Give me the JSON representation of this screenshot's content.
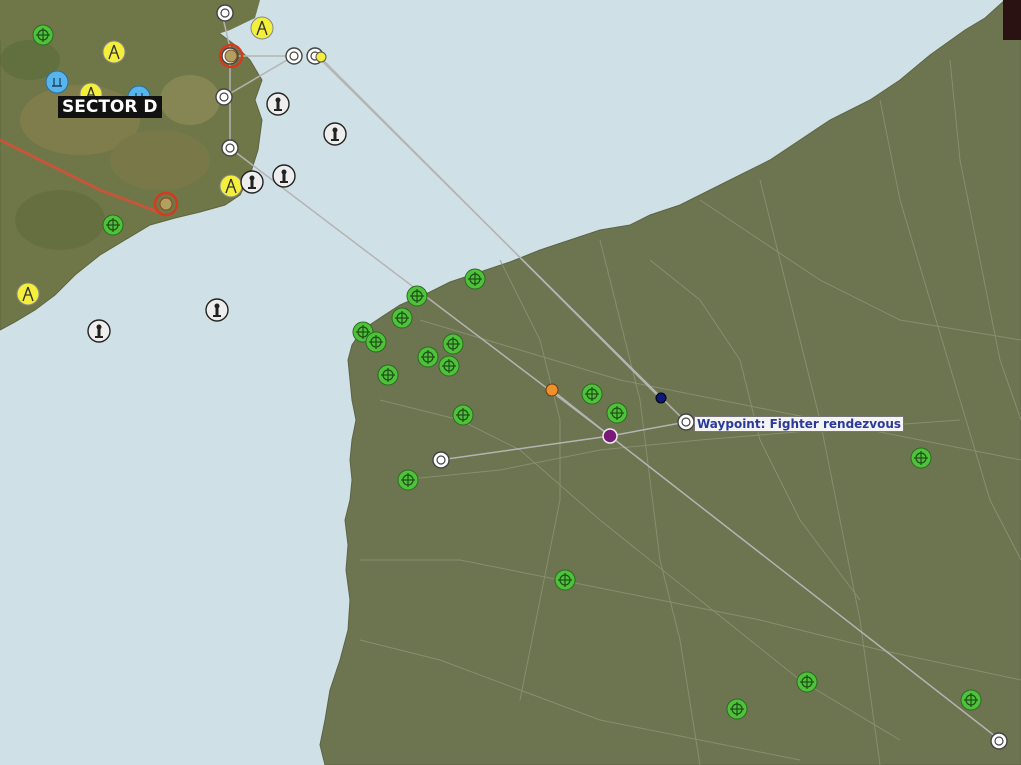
{
  "map": {
    "sector_label": "SECTOR D",
    "waypoint_label": "Waypoint: Fighter rendezvous",
    "colors": {
      "sea": "#cfe1e6",
      "land_france": "#6c7450",
      "land_england": "#6f7748",
      "route_line": "#a8a8a8",
      "friendly_airfield": "#4ec23a",
      "industry": "#f3ef3a",
      "radar": "#58b4ec",
      "target_orange": "#f0902a",
      "target_purple": "#7a1a78",
      "flight_dark_blue": "#0d1a7a"
    },
    "icons": {
      "airfield": "crosshair-airfield-icon",
      "industry": "radio-tower-icon",
      "radar": "radar-icon",
      "ship": "ship-icon",
      "waypoint": "waypoint-ring-icon",
      "flak": "flak-target-icon"
    }
  }
}
